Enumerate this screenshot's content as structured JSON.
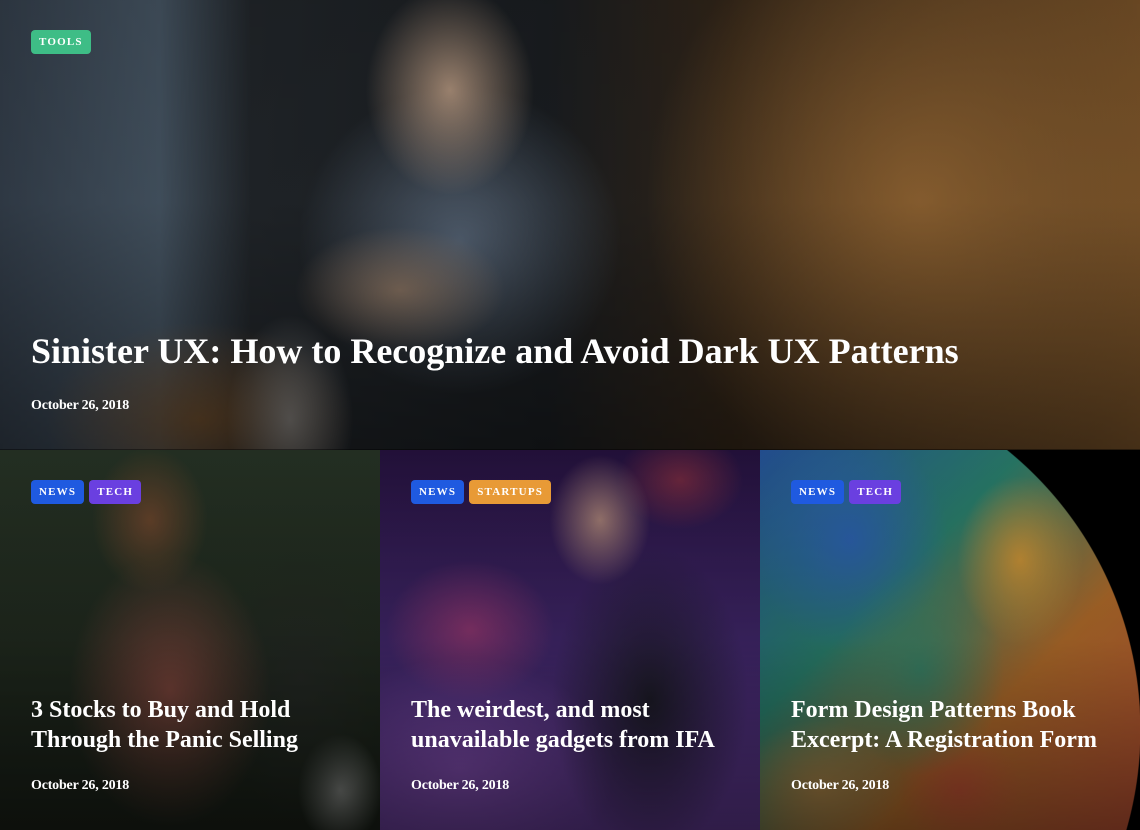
{
  "colors": {
    "tools": "#3ebd86",
    "news": "#1f5ae0",
    "tech": "#6a3fe0",
    "startups": "#e89a36"
  },
  "hero": {
    "tags": [
      {
        "label": "TOOLS",
        "color": "tools"
      }
    ],
    "title": "Sinister UX: How to Recognize and Avoid Dark UX Patterns",
    "date": "October 26, 2018"
  },
  "cards": [
    {
      "tags": [
        {
          "label": "NEWS",
          "color": "news"
        },
        {
          "label": "TECH",
          "color": "tech"
        }
      ],
      "title": "3 Stocks to Buy and Hold Through the Panic Selling",
      "date": "October 26, 2018"
    },
    {
      "tags": [
        {
          "label": "NEWS",
          "color": "news"
        },
        {
          "label": "STARTUPS",
          "color": "startups"
        }
      ],
      "title": "The weirdest, and most unavailable gadgets from IFA",
      "date": "October 26, 2018"
    },
    {
      "tags": [
        {
          "label": "NEWS",
          "color": "news"
        },
        {
          "label": "TECH",
          "color": "tech"
        }
      ],
      "title": "Form Design Patterns Book Excerpt: A Registration Form",
      "date": "October 26, 2018"
    }
  ]
}
